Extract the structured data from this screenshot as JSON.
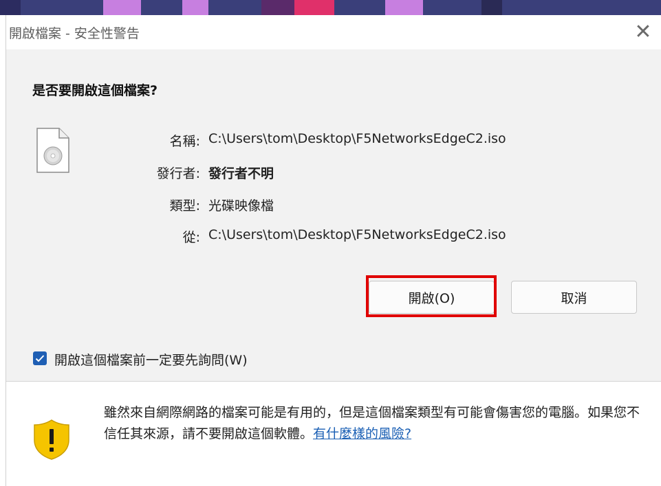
{
  "dialog": {
    "title": "開啟檔案 - 安全性警告",
    "close_glyph": "✕",
    "question": "是否要開啟這個檔案?"
  },
  "file_info": {
    "name_label": "名稱:",
    "name_value": "C:\\Users\\tom\\Desktop\\F5NetworksEdgeC2.iso",
    "publisher_label": "發行者:",
    "publisher_value": "發行者不明",
    "type_label": "類型:",
    "type_value": "光碟映像檔",
    "from_label": "從:",
    "from_value": "C:\\Users\\tom\\Desktop\\F5NetworksEdgeC2.iso",
    "icon": "disc-image-file-icon"
  },
  "buttons": {
    "open_label": "開啟(O)",
    "cancel_label": "取消"
  },
  "checkbox": {
    "label": "開啟這個檔案前一定要先詢問(W)",
    "checked": true
  },
  "warning": {
    "icon": "shield-warning-icon",
    "text": "雖然來自網際網路的檔案可能是有用的，但是這個檔案類型有可能會傷害您的電腦。如果您不信任其來源，請不要開啟這個軟體。",
    "link_text": "有什麼樣的風險?"
  },
  "colors": {
    "accent": "#1f5fb4",
    "highlight": "#e00000",
    "shield": "#f5c400"
  }
}
